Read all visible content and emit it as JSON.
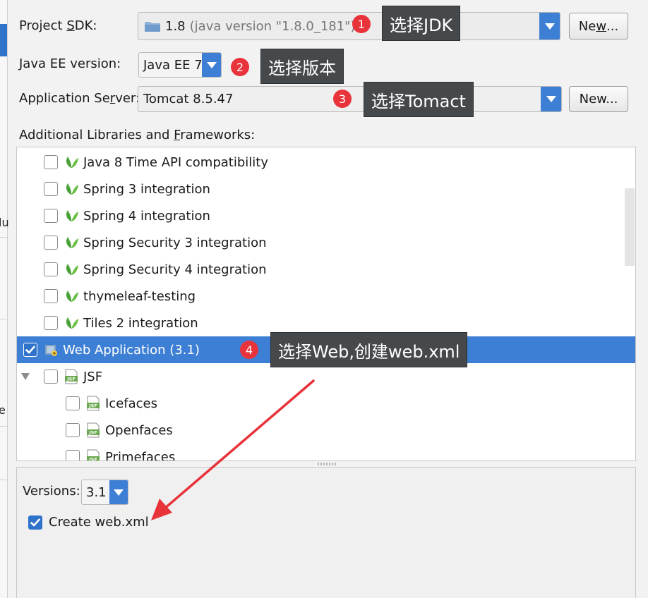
{
  "parent_window": {
    "fragments": [
      "lu",
      "e"
    ]
  },
  "sdk": {
    "label_prefix": "Project ",
    "label_mnemonic": "S",
    "label_suffix": "DK:",
    "value": "1.8",
    "detail": "(java version \"1.8.0_181\")",
    "new_button_prefix": "Ne",
    "new_button_mnemonic": "w",
    "new_button_suffix": "..."
  },
  "javaee": {
    "label": "Java EE version:",
    "value": "Java EE 7"
  },
  "server": {
    "label_prefix": "Application Se",
    "label_mnemonic": "r",
    "label_suffix": "ver:",
    "value": "Tomcat 8.5.47",
    "new_button": "New..."
  },
  "libraries": {
    "label_prefix": "Additional Libraries and ",
    "label_mnemonic": "F",
    "label_suffix": "rameworks:",
    "items": [
      {
        "label": "Java 8 Time API compatibility",
        "checked": false,
        "icon": "leaf-icon"
      },
      {
        "label": "Spring 3 integration",
        "checked": false,
        "icon": "leaf-icon"
      },
      {
        "label": "Spring 4 integration",
        "checked": false,
        "icon": "leaf-icon"
      },
      {
        "label": "Spring Security 3 integration",
        "checked": false,
        "icon": "leaf-icon"
      },
      {
        "label": "Spring Security 4 integration",
        "checked": false,
        "icon": "leaf-icon"
      },
      {
        "label": "thymeleaf-testing",
        "checked": false,
        "icon": "leaf-icon"
      },
      {
        "label": "Tiles 2 integration",
        "checked": false,
        "icon": "leaf-icon"
      },
      {
        "label": "Web Application (3.1)",
        "checked": true,
        "icon": "web-module-icon",
        "selected": true
      },
      {
        "label": "JSF",
        "checked": false,
        "icon": "jsf-icon",
        "expanded": true
      },
      {
        "label": "Icefaces",
        "checked": false,
        "icon": "jsf-icon"
      },
      {
        "label": "Openfaces",
        "checked": false,
        "icon": "jsf-icon"
      },
      {
        "label": "Primefaces",
        "checked": false,
        "icon": "jsf-icon"
      }
    ],
    "jsf_badge_text": "JSF"
  },
  "versions": {
    "label": "Versions:",
    "value": "3.1"
  },
  "create_webxml": {
    "label": "Create web.xml",
    "checked": true
  },
  "annotations": [
    {
      "number": "1",
      "text": "选择JDK"
    },
    {
      "number": "2",
      "text": "选择版本"
    },
    {
      "number": "3",
      "text": "选择Tomact"
    },
    {
      "number": "4",
      "text": "选择Web,创建web.xml"
    }
  ],
  "colors": {
    "accent": "#3d7fd4",
    "badge": "#e8333a",
    "callout": "#46494c",
    "arrow": "#e8333a",
    "leaf": "#4fa83d"
  }
}
